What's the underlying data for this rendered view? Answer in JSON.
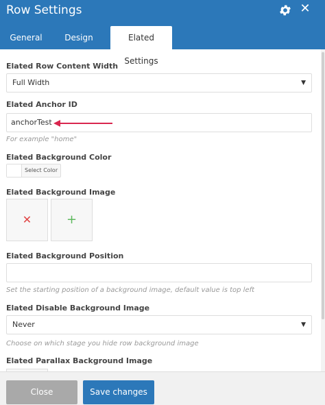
{
  "window": {
    "title": "Row Settings"
  },
  "tabs": [
    {
      "label": "General"
    },
    {
      "label": "Design Options"
    },
    {
      "label": "Elated Settings"
    }
  ],
  "fields": {
    "row_content_width": {
      "label": "Elated Row Content Width",
      "value": "Full Width"
    },
    "anchor_id": {
      "label": "Elated Anchor ID",
      "value": "anchorTest",
      "help": "For example \"home\""
    },
    "background_color": {
      "label": "Elated Background Color",
      "button": "Select Color"
    },
    "background_image": {
      "label": "Elated Background Image"
    },
    "background_position": {
      "label": "Elated Background Position",
      "value": "",
      "help": "Set the starting position of a background image, default value is top left"
    },
    "disable_background_image": {
      "label": "Elated Disable Background Image",
      "value": "Never",
      "help": "Choose on which stage you hide row background image"
    },
    "parallax_background_image": {
      "label": "Elated Parallax Background Image"
    }
  },
  "footer": {
    "close_label": "Close",
    "save_label": "Save changes"
  },
  "icons": {
    "settings": "gear-icon",
    "close": "close-icon",
    "remove": "remove-icon",
    "add": "add-icon",
    "arrow": "arrow-annotation",
    "caret": "caret-down-icon"
  },
  "colors": {
    "header": "#2c78b9",
    "save": "#2c78b9",
    "close_btn": "#a9a9a9",
    "arrow": "#d9264e"
  }
}
